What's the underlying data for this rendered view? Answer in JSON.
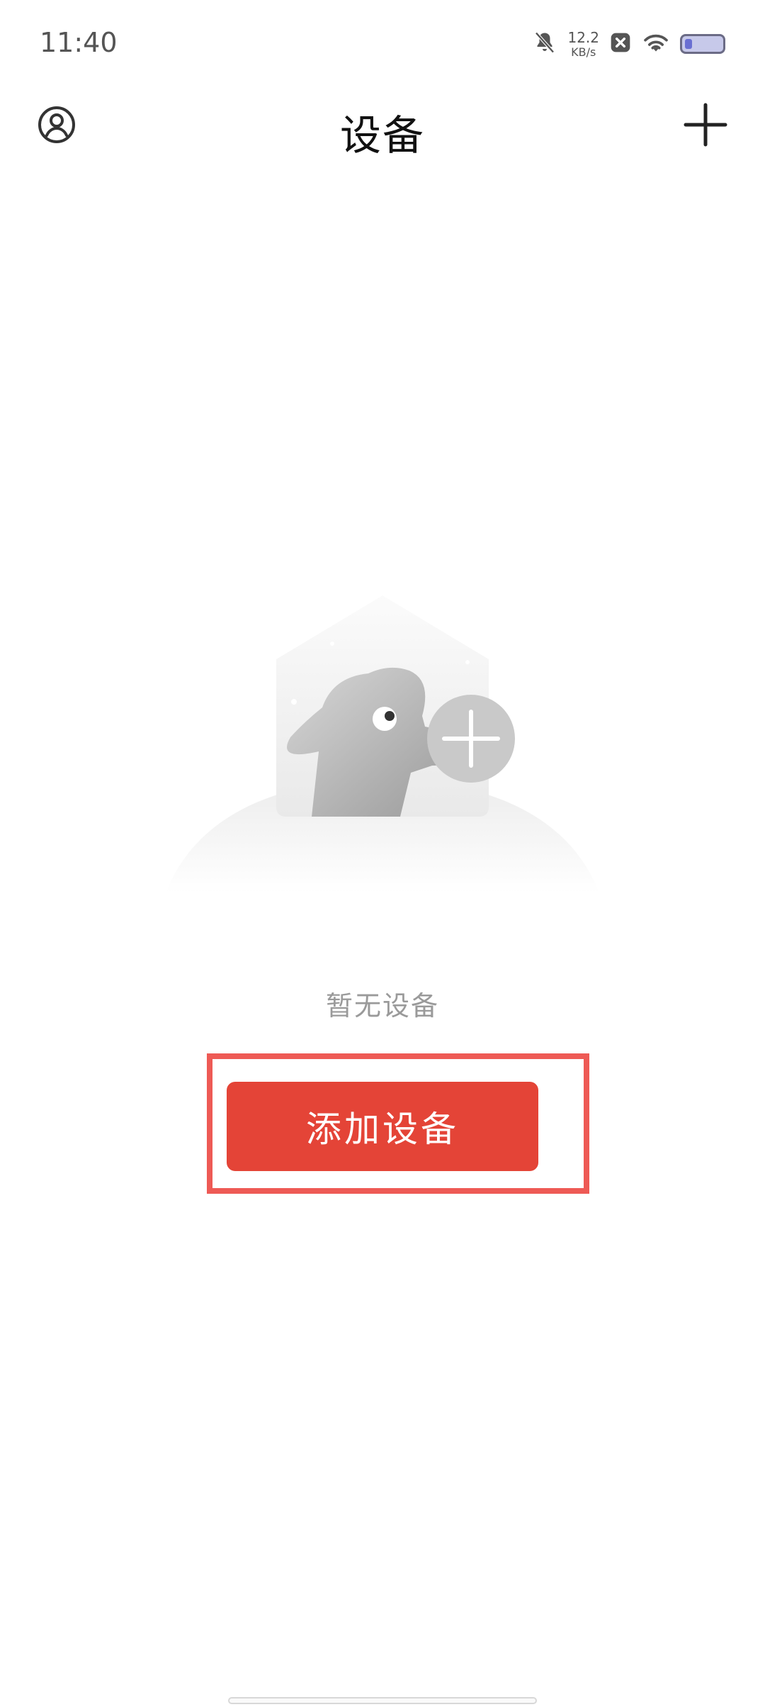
{
  "status_bar": {
    "time": "11:40",
    "network_speed_value": "12.2",
    "network_speed_unit": "KB/s",
    "icons": [
      "bell-muted-icon",
      "close-square-icon",
      "wifi-icon",
      "battery-icon"
    ],
    "battery_color": "#6a6fd2"
  },
  "header": {
    "title": "设备",
    "left_icon": "account-circle-icon",
    "right_icon": "plus-icon"
  },
  "main": {
    "illustration_icon": "empty-devices-illustration-icon",
    "empty_message": "暂无设备",
    "add_button_label": "添加设备",
    "accent_color": "#e44437",
    "highlight_color": "#ee5a55"
  }
}
